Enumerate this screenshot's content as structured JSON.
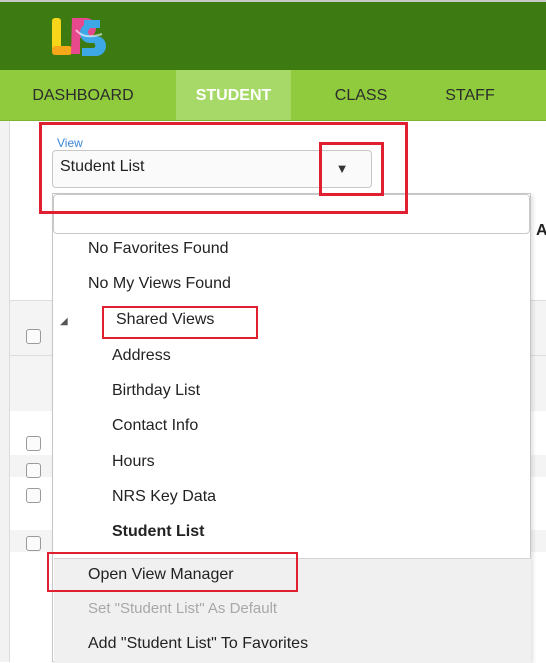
{
  "nav": {
    "tabs": [
      "DASHBOARD",
      "STUDENT",
      "CLASS",
      "STAFF"
    ],
    "active": "STUDENT"
  },
  "view": {
    "label": "View",
    "selected": "Student List"
  },
  "page": {
    "right_cut_text": "A"
  },
  "dropdown": {
    "no_favorites": "No Favorites Found",
    "no_my_views": "No My Views Found",
    "shared_views": "Shared Views",
    "items": [
      "Address",
      "Birthday List",
      "Contact Info",
      "Hours",
      "NRS Key Data",
      "Student List"
    ],
    "actions": {
      "open_manager": "Open View Manager",
      "set_default": "Set \"Student List\" As Default",
      "add_favorites": "Add \"Student List\" To Favorites"
    }
  },
  "colors": {
    "header": "#3e7a12",
    "nav": "#8fcb3c",
    "nav_active": "#a6d968",
    "highlight": "#e02030",
    "link": "#3a86d6"
  },
  "icons": {
    "dropdown_arrow": "▼",
    "tree_expanded": "◢"
  }
}
